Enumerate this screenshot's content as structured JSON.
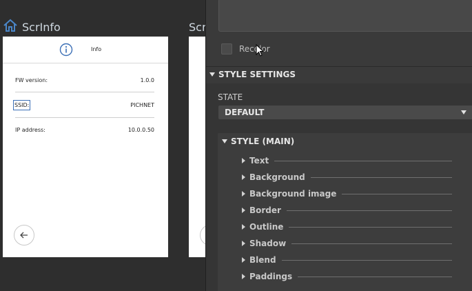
{
  "canvas": {
    "screen_name": "ScrInfo",
    "screen2_name": "Scr",
    "header": {
      "title": "Info"
    },
    "rows": [
      {
        "label": "FW version:",
        "value": "1.0.0"
      },
      {
        "label": "SSID:",
        "value": "PICHNET"
      },
      {
        "label": "IP address:",
        "value": "10.0.0.50"
      }
    ]
  },
  "panel": {
    "recolor_label": "Recolor",
    "style_settings_title": "STYLE SETTINGS",
    "state_label": "STATE",
    "state_value": "DEFAULT",
    "style_main_title": "STYLE (MAIN)",
    "properties": [
      "Text",
      "Background",
      "Background image",
      "Border",
      "Outline",
      "Shadow",
      "Blend",
      "Paddings"
    ]
  },
  "colors": {
    "accent": "#3b6fb6",
    "panel_bg": "#3a3a3a",
    "canvas_bg": "#2e2e2e"
  }
}
